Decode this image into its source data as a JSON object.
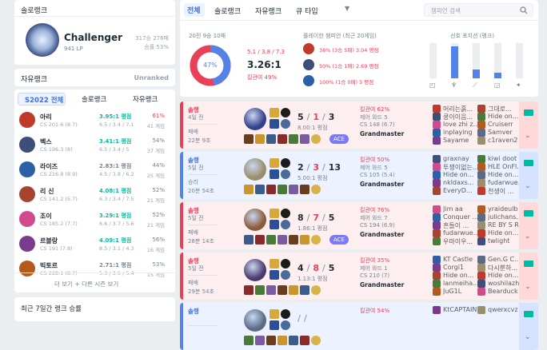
{
  "solo": {
    "title": "솔로랭크",
    "tier": "Challenger",
    "lp": "941 LP",
    "record": "317승 276패",
    "winrate": "승률 53%"
  },
  "flex": {
    "title": "자유랭크",
    "status": "Unranked"
  },
  "season": {
    "tabs": [
      "S2022 전체",
      "솔로랭크",
      "자유랭크"
    ],
    "champs": [
      {
        "name": "아리",
        "cs": "CS 201.6 (8.7)",
        "kda": "3.95:1 평점",
        "kda_detail": "6.5 / 3.4 / 7.1",
        "wr": "61%",
        "games": "41 게임",
        "color": "#c0392b",
        "kdacolor": "#00bba3",
        "wrcolor": "#e84057"
      },
      {
        "name": "벡스",
        "cs": "CS 196.3 (8)",
        "kda": "3.41:1 평점",
        "kda_detail": "6.5 / 3.4 / 5",
        "wr": "54%",
        "games": "37 게임",
        "color": "#3d4e7a",
        "kdacolor": "#00bba3",
        "wrcolor": "#758592"
      },
      {
        "name": "라이즈",
        "cs": "CS 216.8 (8.9)",
        "kda": "2.83:1 평점",
        "kda_detail": "4.5 / 3.8 / 6.2",
        "wr": "44%",
        "games": "25 게임",
        "color": "#2b5fa8",
        "kdacolor": "#758592",
        "wrcolor": "#758592"
      },
      {
        "name": "리 신",
        "cs": "CS 141.2 (5.7)",
        "kda": "4.08:1 평점",
        "kda_detail": "6.3 / 3.4 / 7.5",
        "wr": "52%",
        "games": "21 게임",
        "color": "#a8432f",
        "kdacolor": "#00bba3",
        "wrcolor": "#758592"
      },
      {
        "name": "조이",
        "cs": "CS 185.2 (7.7)",
        "kda": "3.29:1 평점",
        "kda_detail": "6.6 / 3.7 / 5.6",
        "wr": "52%",
        "games": "21 게임",
        "color": "#d24a8e",
        "kdacolor": "#00bba3",
        "wrcolor": "#758592"
      },
      {
        "name": "르블랑",
        "cs": "CS 191 (7.8)",
        "kda": "4.09:1 평점",
        "kda_detail": "8.5 / 3.1 / 4.3",
        "wr": "56%",
        "games": "16 게임",
        "color": "#7a3b8f",
        "kdacolor": "#00bba3",
        "wrcolor": "#758592"
      },
      {
        "name": "빅토르",
        "cs": "CS 228.1 (8.7)",
        "kda": "2.71:1 평점",
        "kda_detail": "5.3 / 3.6 / 5.4",
        "wr": "53%",
        "games": "15 게임",
        "color": "#b45a1e",
        "kdacolor": "#758592",
        "wrcolor": "#758592"
      }
    ],
    "more": "더 보기 + 다른 시즌 보기"
  },
  "recent": {
    "title": "최근 7일간 랭크 승률"
  },
  "tabs": {
    "all": "전체",
    "solo": "솔로랭크",
    "flex": "자유랭크",
    "queue": "큐 타입",
    "search_placeholder": "챔피언 검색"
  },
  "summary": {
    "record": "20전 9승 10패",
    "winrate": "47%",
    "winrate_value": 47,
    "kda_detail": "5.1 / 3.8 / 7.3",
    "kda": "3.26:1",
    "kill_part": "킬관여 49%"
  },
  "played": {
    "title": "플레이한 챔피언 (최근 20게임)",
    "champs": [
      {
        "text": "36% (3승 5패) 3.04 평점",
        "color": "#c0392b"
      },
      {
        "text": "50% (1승 1패) 2.69 평점",
        "color": "#3d4e7a"
      },
      {
        "text": "100% (1승 0패) 5 평점",
        "color": "#2b5fa8"
      }
    ]
  },
  "position": {
    "title": "선호 포지션 (랭크)",
    "levels": [
      0.0,
      0.9,
      0.25,
      0.15,
      0.0
    ]
  },
  "games": [
    {
      "result": "loss",
      "type": "솔랭",
      "ago": "4일 전",
      "outcome": "패배",
      "dur": "22분 9초",
      "kills": "5",
      "deaths": "1",
      "assists": "3",
      "kda": "8.00:1 평점",
      "kp": "킬관여 62%",
      "lvl": "제어 와드 5",
      "cs": "CS 148 (6.7)",
      "tier": "Grandmaster",
      "badge": "ACE",
      "champ": "#34408a",
      "team1": [
        "머리는흙...",
        "쿵이이음...",
        "love zhi z...",
        "inplaying",
        "Sayame"
      ],
      "team2": [
        "그대로...",
        "Hide on...",
        "Cruiserr",
        "Samver",
        "c1raven2"
      ]
    },
    {
      "result": "win",
      "type": "솔랭",
      "ago": "5일 전",
      "outcome": "승리",
      "dur": "20분 54초",
      "kills": "2",
      "deaths": "3",
      "assists": "13",
      "kda": "5.00:1 평점",
      "kp": "킬관여 50%",
      "lvl": "제어 와드 5",
      "cs": "CS 105 (5.4)",
      "tier": "Grandmaster",
      "badge": "",
      "champ": "#9a8f6c",
      "team1": [
        "graxnay",
        "투쟁이없는...",
        "Hide on...",
        "nkldaxs...",
        "EveryD..."
      ],
      "team2": [
        "kiwi doot",
        "HLE OnFl...",
        "Hide on...",
        "fudarwue...",
        "천생이 ..."
      ]
    },
    {
      "result": "loss",
      "type": "솔랭",
      "ago": "5일 전",
      "outcome": "패배",
      "dur": "28분 14초",
      "kills": "8",
      "deaths": "7",
      "assists": "5",
      "kda": "1.86:1 평점",
      "kp": "킬관여 76%",
      "lvl": "제어 와드 7",
      "cs": "CS 194 (6.9)",
      "tier": "Grandmaster",
      "badge": "ACE",
      "champ": "#8a5c3a",
      "team1": [
        "Jim aa",
        "Conquer ...",
        "흔들이 ...",
        "fudarwue...",
        "우마이우..."
      ],
      "team2": [
        "yraideulb",
        "julichans...",
        "RE BY S R",
        "Hide on...",
        "twlight"
      ]
    },
    {
      "result": "loss",
      "type": "솔랭",
      "ago": "5일 전",
      "outcome": "패배",
      "dur": "29분 54초",
      "kills": "4",
      "deaths": "8",
      "assists": "5",
      "kda": "1.13:1 평점",
      "kp": "킬관여 35%",
      "lvl": "제어 와드 1",
      "cs": "CS 210 (7)",
      "tier": "Grandmaster",
      "badge": "",
      "champ": "#4a3a6e",
      "team1": [
        "KT Castle",
        "Corgi1",
        "Hide on...",
        "lanmeiha...",
        "JuG1L"
      ],
      "team2": [
        "Gen.G C...",
        "다시뿐하...",
        "Hide on...",
        "woshilazhu",
        "Bearduck"
      ]
    },
    {
      "result": "win",
      "type": "솔랭",
      "ago": "",
      "outcome": "",
      "dur": "",
      "kills": "",
      "deaths": "",
      "assists": "",
      "kda": "",
      "kp": "킬관여 54%",
      "lvl": "",
      "cs": "",
      "tier": "",
      "badge": "",
      "champ": "#5a6b8a",
      "team1": [
        "KtCAPTAIN"
      ],
      "team2": [
        "qwerxcvz"
      ]
    }
  ]
}
